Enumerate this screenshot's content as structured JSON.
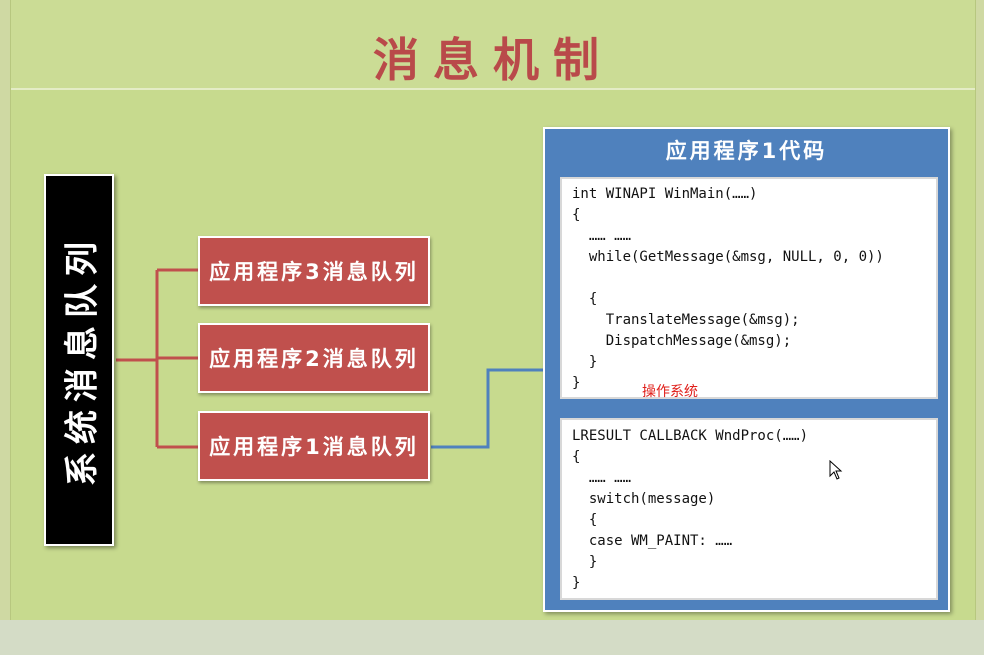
{
  "title": "消息机制",
  "system_queue": {
    "label": "系统消息队列"
  },
  "app_queues": [
    {
      "label": "应用程序3消息队列"
    },
    {
      "label": "应用程序2消息队列"
    },
    {
      "label": "应用程序1消息队列"
    }
  ],
  "code_panel": {
    "title": "应用程序1代码",
    "winmain_lines": [
      "int WINAPI WinMain(……)",
      "{",
      "  …… ……",
      "  while(GetMessage(&msg, NULL, 0, 0))",
      "",
      "  {",
      "    TranslateMessage(&msg);",
      "    DispatchMessage(&msg);",
      "  }",
      "}"
    ],
    "wndproc_lines": [
      "LRESULT CALLBACK WndProc(……)",
      "{",
      "  …… ……",
      "  switch(message)",
      "  {",
      "  case WM_PAINT: ……",
      "  }",
      "}"
    ]
  },
  "annotation": {
    "label": "操作系统"
  },
  "colors": {
    "background": "#c7da8e",
    "title": "#b94a4a",
    "queue_box": "#c0504d",
    "code_panel": "#4f81bd",
    "connector_red": "#c0504d",
    "connector_blue": "#4f81bd",
    "annotation": "#e0201b"
  }
}
